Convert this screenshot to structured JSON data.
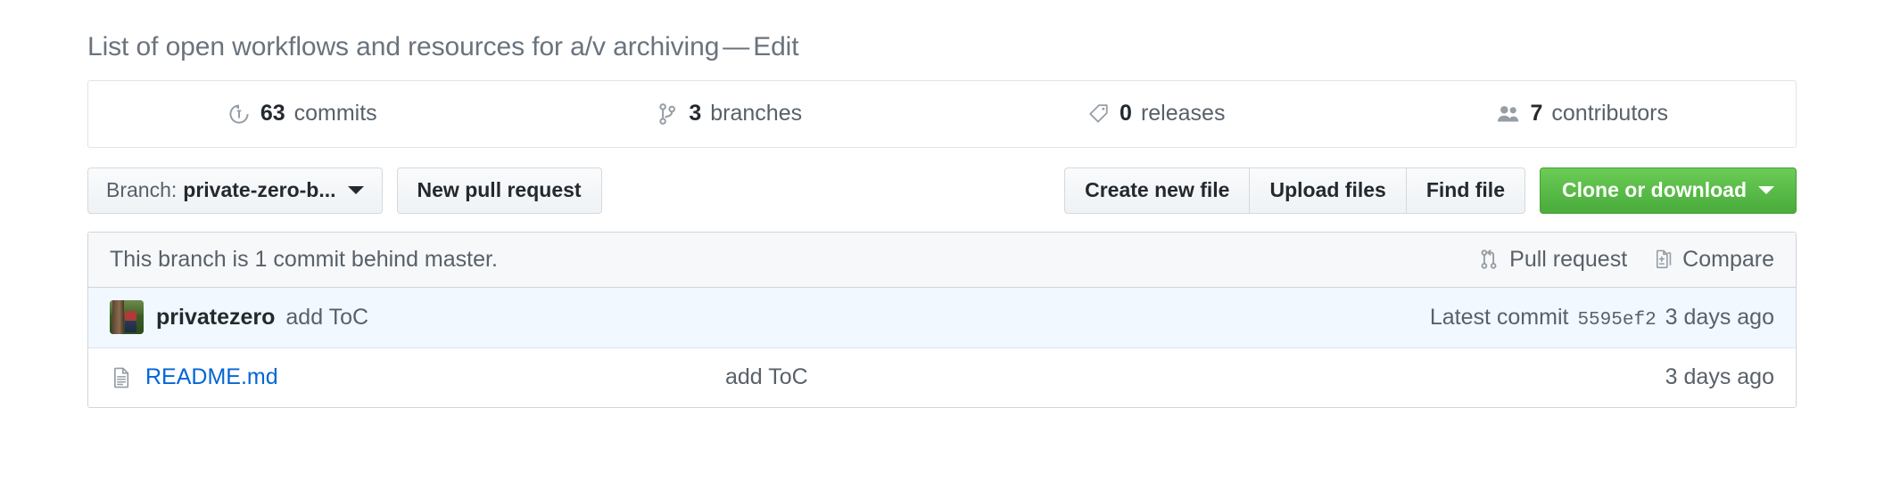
{
  "repo": {
    "title": "List of open workflows and resources for a/v archiving",
    "separator": "—",
    "edit_label": "Edit"
  },
  "stats": [
    {
      "icon": "history-icon",
      "count": "63",
      "label": "commits"
    },
    {
      "icon": "git-branch-icon",
      "count": "3",
      "label": "branches"
    },
    {
      "icon": "tag-icon",
      "count": "0",
      "label": "releases"
    },
    {
      "icon": "people-icon",
      "count": "7",
      "label": "contributors"
    }
  ],
  "toolbar": {
    "branch_prefix": "Branch:",
    "branch_name": "private-zero-b...",
    "new_pull_request": "New pull request",
    "create_new_file": "Create new file",
    "upload_files": "Upload files",
    "find_file": "Find file",
    "clone_or_download": "Clone or download"
  },
  "branch_status": {
    "text": "This branch is 1 commit behind master.",
    "pull_request": "Pull request",
    "compare": "Compare"
  },
  "latest_commit": {
    "author": "privatezero",
    "message": "add ToC",
    "latest_label": "Latest commit",
    "sha": "5595ef2",
    "age": "3 days ago"
  },
  "files": [
    {
      "icon": "file-icon",
      "name": "README.md",
      "message": "add ToC",
      "age": "3 days ago"
    }
  ],
  "colors": {
    "link": "#0366d6",
    "green_button": "#60b044",
    "commit_row_bg": "#f1f8ff",
    "status_bar_bg": "#f6f8fa",
    "muted_text": "#586069"
  }
}
